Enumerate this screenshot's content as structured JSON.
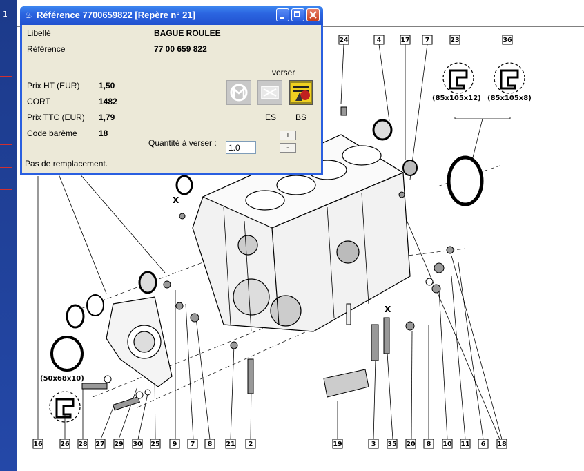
{
  "background": {
    "top_char": "1"
  },
  "dialog": {
    "title": "Référence 7700659822 [Repère n°  21]",
    "labels": {
      "libelle": "Libellé",
      "reference": "Référence",
      "prix_ht": "Prix HT (EUR)",
      "cort": "CORT",
      "prix_ttc": "Prix TTC (EUR)",
      "code_bareme": "Code barème",
      "verser": "verser",
      "es": "ES",
      "bs": "BS",
      "quantite": "Quantité à verser :"
    },
    "values": {
      "libelle": "BAGUE ROULEE",
      "reference": "77 00 659 822",
      "prix_ht": "1,50",
      "cort": "1482",
      "prix_ttc": "1,79",
      "code_bareme": "18"
    },
    "quantity": "1.0",
    "spin_up": "+",
    "spin_down": "-",
    "status": "Pas de remplacement."
  },
  "diagram": {
    "top_callouts": [
      "24",
      "4",
      "17",
      "7",
      "23",
      "36"
    ],
    "dims_right": [
      "(85x105x12)",
      "(85x105x8)"
    ],
    "dim_left": "(50x68x10)",
    "bottom_callouts": [
      "16",
      "26",
      "28",
      "27",
      "29",
      "30",
      "25",
      "9",
      "7",
      "8",
      "21",
      "2",
      "19",
      "3",
      "35",
      "20",
      "8",
      "10",
      "11",
      "6",
      "18"
    ],
    "x_marks": [
      "X",
      "X"
    ]
  },
  "colors": {
    "xp_blue": "#2a5fe0",
    "dialog_bg": "#ece9d8",
    "close_red": "#c8401e"
  }
}
